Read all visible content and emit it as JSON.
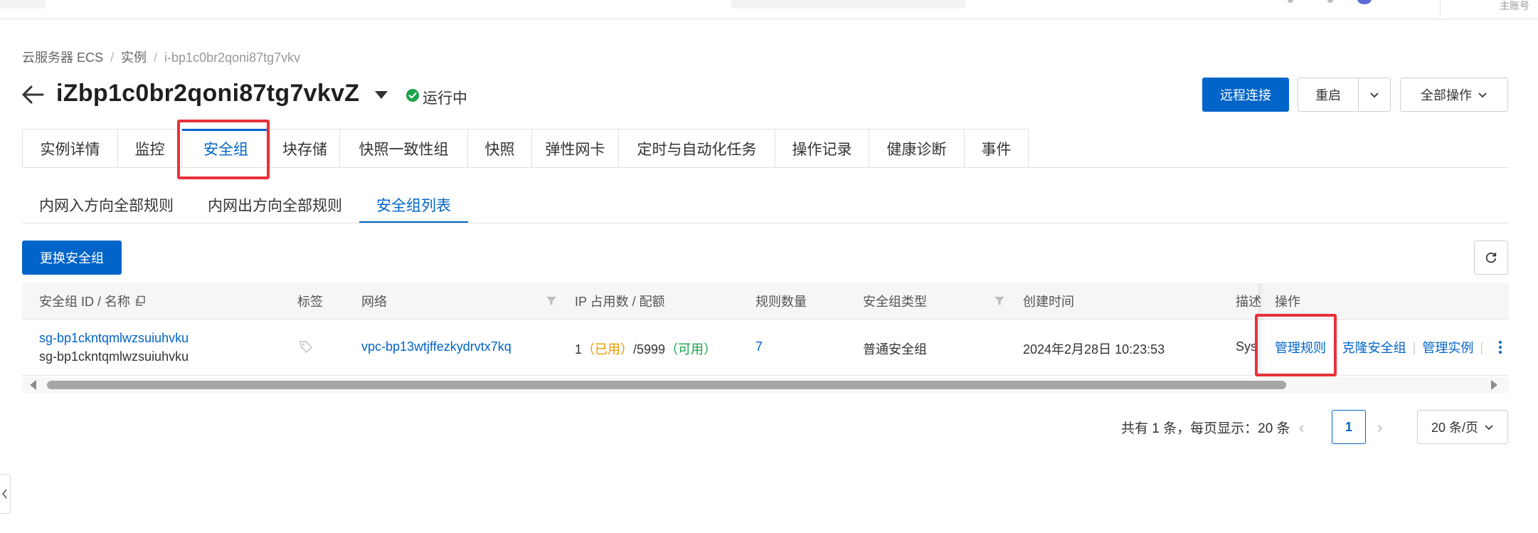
{
  "topbar": {
    "account_label": "主账号"
  },
  "breadcrumb": {
    "items": [
      "云服务器 ECS",
      "实例",
      "i-bp1c0br2qoni87tg7vkv"
    ]
  },
  "header": {
    "instance_name": "iZbp1c0br2qoni87tg7vkvZ",
    "status": "运行中",
    "remote_connect": "远程连接",
    "restart": "重启",
    "all_actions": "全部操作"
  },
  "tabs": [
    "实例详情",
    "监控",
    "安全组",
    "块存储",
    "快照一致性组",
    "快照",
    "弹性网卡",
    "定时与自动化任务",
    "操作记录",
    "健康诊断",
    "事件"
  ],
  "active_tab": "安全组",
  "subtabs": [
    "内网入方向全部规则",
    "内网出方向全部规则",
    "安全组列表"
  ],
  "active_subtab": "安全组列表",
  "toolbar": {
    "change_sg": "更换安全组"
  },
  "table": {
    "columns": [
      "安全组 ID / 名称",
      "标签",
      "网络",
      "IP 占用数 / 配额",
      "规则数量",
      "安全组类型",
      "创建时间",
      "描述",
      "操作"
    ],
    "row": {
      "sg_id": "sg-bp1ckntqmlwzsuiuhvku",
      "sg_name": "sg-bp1ckntqmlwzsuiuhvku",
      "network": "vpc-bp13wtjffezkydrvtx7kq",
      "ip_used": "1",
      "ip_used_label": "已用",
      "ip_quota": "/5999",
      "ip_quota_label": "可用",
      "rule_count": "7",
      "sg_type": "普通安全组",
      "created": "2024年2月28日 10:23:53",
      "description": "Sys",
      "actions": [
        "管理规则",
        "克隆安全组",
        "管理实例"
      ]
    }
  },
  "pagination": {
    "total_text": "共有 1 条，每页显示：20 条",
    "current_page": "1",
    "page_size": "20 条/页"
  },
  "colors": {
    "primary": "#0064c8",
    "highlight": "#e8313a",
    "success": "#1aa34a",
    "warning": "#e89a00"
  }
}
